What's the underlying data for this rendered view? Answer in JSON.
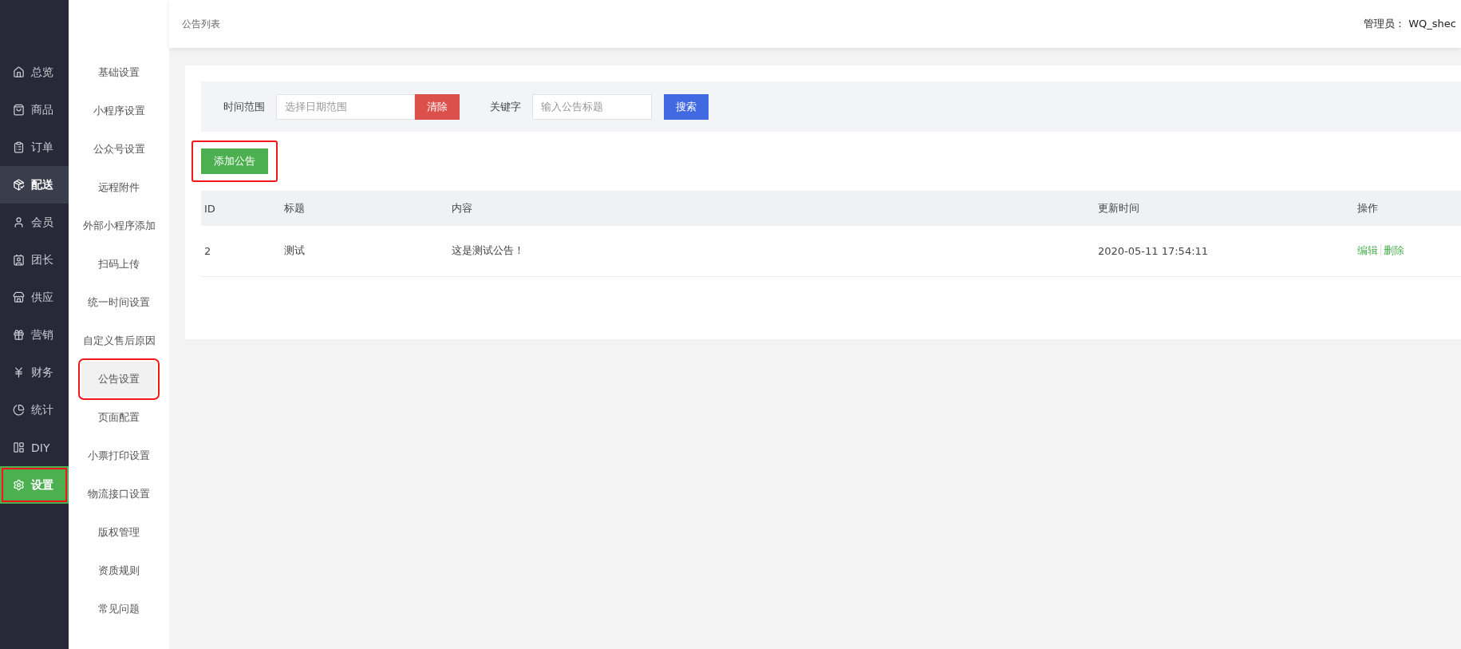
{
  "main_nav": [
    {
      "label": "总览",
      "selected": false,
      "highlighted": false,
      "outlined": false
    },
    {
      "label": "商品",
      "selected": false,
      "highlighted": false,
      "outlined": false
    },
    {
      "label": "订单",
      "selected": false,
      "highlighted": false,
      "outlined": false
    },
    {
      "label": "配送",
      "selected": false,
      "highlighted": true,
      "outlined": false
    },
    {
      "label": "会员",
      "selected": false,
      "highlighted": false,
      "outlined": false
    },
    {
      "label": "团长",
      "selected": false,
      "highlighted": false,
      "outlined": false
    },
    {
      "label": "供应",
      "selected": false,
      "highlighted": false,
      "outlined": false
    },
    {
      "label": "营销",
      "selected": false,
      "highlighted": false,
      "outlined": false
    },
    {
      "label": "财务",
      "selected": false,
      "highlighted": false,
      "outlined": false
    },
    {
      "label": "统计",
      "selected": false,
      "highlighted": false,
      "outlined": false
    },
    {
      "label": "DIY",
      "selected": false,
      "highlighted": false,
      "outlined": false
    },
    {
      "label": "设置",
      "selected": true,
      "highlighted": false,
      "outlined": true
    }
  ],
  "sub_nav": [
    {
      "label": "基础设置",
      "selected": false,
      "outlined": false
    },
    {
      "label": "小程序设置",
      "selected": false,
      "outlined": false
    },
    {
      "label": "公众号设置",
      "selected": false,
      "outlined": false
    },
    {
      "label": "远程附件",
      "selected": false,
      "outlined": false
    },
    {
      "label": "外部小程序添加",
      "selected": false,
      "outlined": false
    },
    {
      "label": "扫码上传",
      "selected": false,
      "outlined": false
    },
    {
      "label": "统一时间设置",
      "selected": false,
      "outlined": false
    },
    {
      "label": "自定义售后原因",
      "selected": false,
      "outlined": false
    },
    {
      "label": "公告设置",
      "selected": true,
      "outlined": true
    },
    {
      "label": "页面配置",
      "selected": false,
      "outlined": false
    },
    {
      "label": "小票打印设置",
      "selected": false,
      "outlined": false
    },
    {
      "label": "物流接口设置",
      "selected": false,
      "outlined": false
    },
    {
      "label": "版权管理",
      "selected": false,
      "outlined": false
    },
    {
      "label": "资质规则",
      "selected": false,
      "outlined": false
    },
    {
      "label": "常见问题",
      "selected": false,
      "outlined": false
    }
  ],
  "header": {
    "title": "公告列表",
    "admin": "管理员： WQ_shec"
  },
  "filter": {
    "date_label": "时间范围",
    "date_placeholder": "选择日期范围",
    "clear_button": "清除",
    "keyword_label": "关键字",
    "keyword_placeholder": "输入公告标题",
    "search_button": "搜索"
  },
  "add_button": {
    "label": "添加公告",
    "outlined": true
  },
  "table": {
    "columns": [
      "ID",
      "标题",
      "内容",
      "更新时间",
      "操作"
    ],
    "rows": [
      {
        "id": "2",
        "title": "测试",
        "content": "这是测试公告！",
        "updated": "2020-05-11 17:54:11",
        "actions": [
          "编辑",
          "删除"
        ]
      }
    ]
  }
}
